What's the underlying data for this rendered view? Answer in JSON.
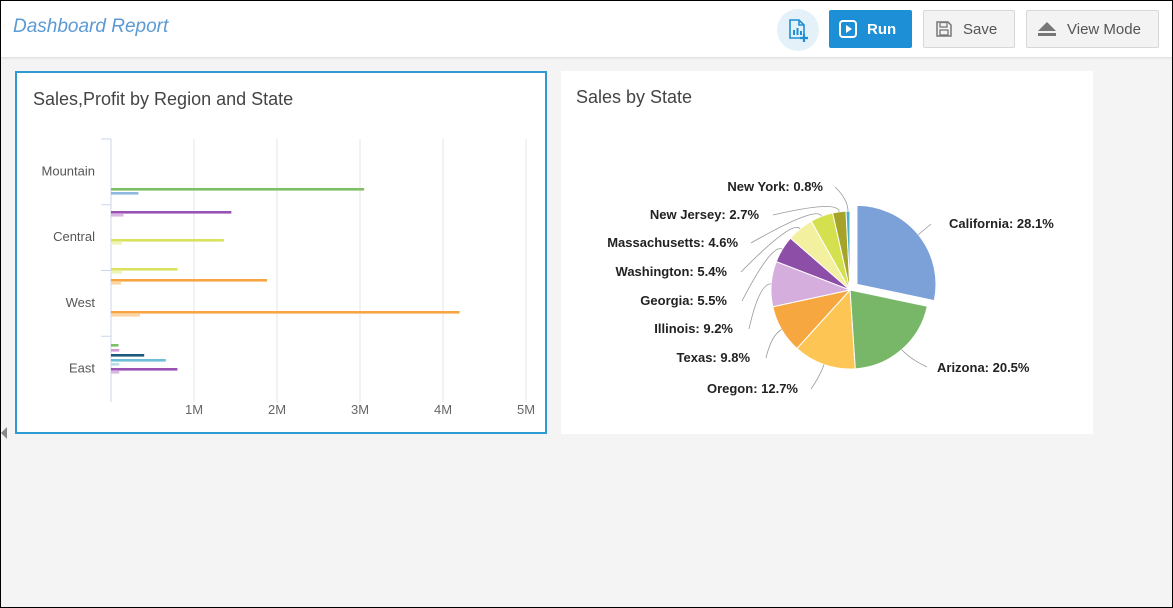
{
  "header": {
    "title": "Dashboard Report",
    "add_chart_icon": "add-chart-icon",
    "run_label": "Run",
    "save_label": "Save",
    "view_mode_label": "View Mode"
  },
  "charts": {
    "left": {
      "title": "Sales,Profit by Region and State"
    },
    "right": {
      "title": "Sales by State"
    }
  },
  "chart_data": [
    {
      "type": "bar",
      "orientation": "horizontal",
      "title": "Sales,Profit by Region and State",
      "categories": [
        "Mountain",
        "Central",
        "West",
        "East"
      ],
      "xlim": [
        0,
        5000000
      ],
      "x_tick_labels": [
        "1M",
        "2M",
        "3M",
        "4M",
        "5M"
      ],
      "x_ticks": [
        1000000,
        2000000,
        3000000,
        4000000,
        5000000
      ],
      "grid": true,
      "bars": [
        {
          "category": "Mountain",
          "value": 3050000,
          "color": "#7cbf64"
        },
        {
          "category": "Mountain",
          "value": 330000,
          "color": "#8fb8df"
        },
        {
          "category": "Central",
          "value": 1450000,
          "color": "#9a52b4"
        },
        {
          "category": "Central",
          "value": 150000,
          "color": "#d8b8e4"
        },
        {
          "category": "Central",
          "value": 1360000,
          "color": "#d9e25d"
        },
        {
          "category": "Central",
          "value": 130000,
          "color": "#eef2b4"
        },
        {
          "category": "West",
          "value": 800000,
          "color": "#d9e25d"
        },
        {
          "category": "West",
          "value": 130000,
          "color": "#eef2b4"
        },
        {
          "category": "West",
          "value": 1880000,
          "color": "#f7a542"
        },
        {
          "category": "West",
          "value": 120000,
          "color": "#fbd6a4"
        },
        {
          "category": "West",
          "value": 4200000,
          "color": "#f7a542"
        },
        {
          "category": "West",
          "value": 350000,
          "color": "#fbd6a4"
        },
        {
          "category": "East",
          "value": 90000,
          "color": "#7cbf64"
        },
        {
          "category": "East",
          "value": 100000,
          "color": "#d69ad3"
        },
        {
          "category": "East",
          "value": 400000,
          "color": "#1a5a7a"
        },
        {
          "category": "East",
          "value": 660000,
          "color": "#6cbfd6"
        },
        {
          "category": "East",
          "value": 100000,
          "color": "#b6dde8"
        },
        {
          "category": "East",
          "value": 800000,
          "color": "#9a52b4"
        },
        {
          "category": "East",
          "value": 100000,
          "color": "#d8b8e4"
        }
      ]
    },
    {
      "type": "pie",
      "title": "Sales by State",
      "slices": [
        {
          "label": "California: 28.1%",
          "name": "California",
          "value": 28.1,
          "color": "#7ba1d8",
          "exploded": true
        },
        {
          "label": "Arizona: 20.5%",
          "name": "Arizona",
          "value": 20.5,
          "color": "#77b767"
        },
        {
          "label": "Oregon: 12.7%",
          "name": "Oregon",
          "value": 12.7,
          "color": "#fdc553"
        },
        {
          "label": "Texas: 9.8%",
          "name": "Texas",
          "value": 9.8,
          "color": "#f7a740"
        },
        {
          "label": "Illinois: 9.2%",
          "name": "Illinois",
          "value": 9.2,
          "color": "#d6aede"
        },
        {
          "label": "Georgia: 5.5%",
          "name": "Georgia",
          "value": 5.5,
          "color": "#8d4ea7"
        },
        {
          "label": "Washington: 5.4%",
          "name": "Washington",
          "value": 5.4,
          "color": "#f3f0a0"
        },
        {
          "label": "Massachusetts: 4.6%",
          "name": "Massachusetts",
          "value": 4.6,
          "color": "#d4e04d"
        },
        {
          "label": "New Jersey: 2.7%",
          "name": "New Jersey",
          "value": 2.7,
          "color": "#a5a429"
        },
        {
          "label": "New York: 0.8%",
          "name": "New York",
          "value": 0.8,
          "color": "#4fb0c6"
        }
      ]
    }
  ]
}
